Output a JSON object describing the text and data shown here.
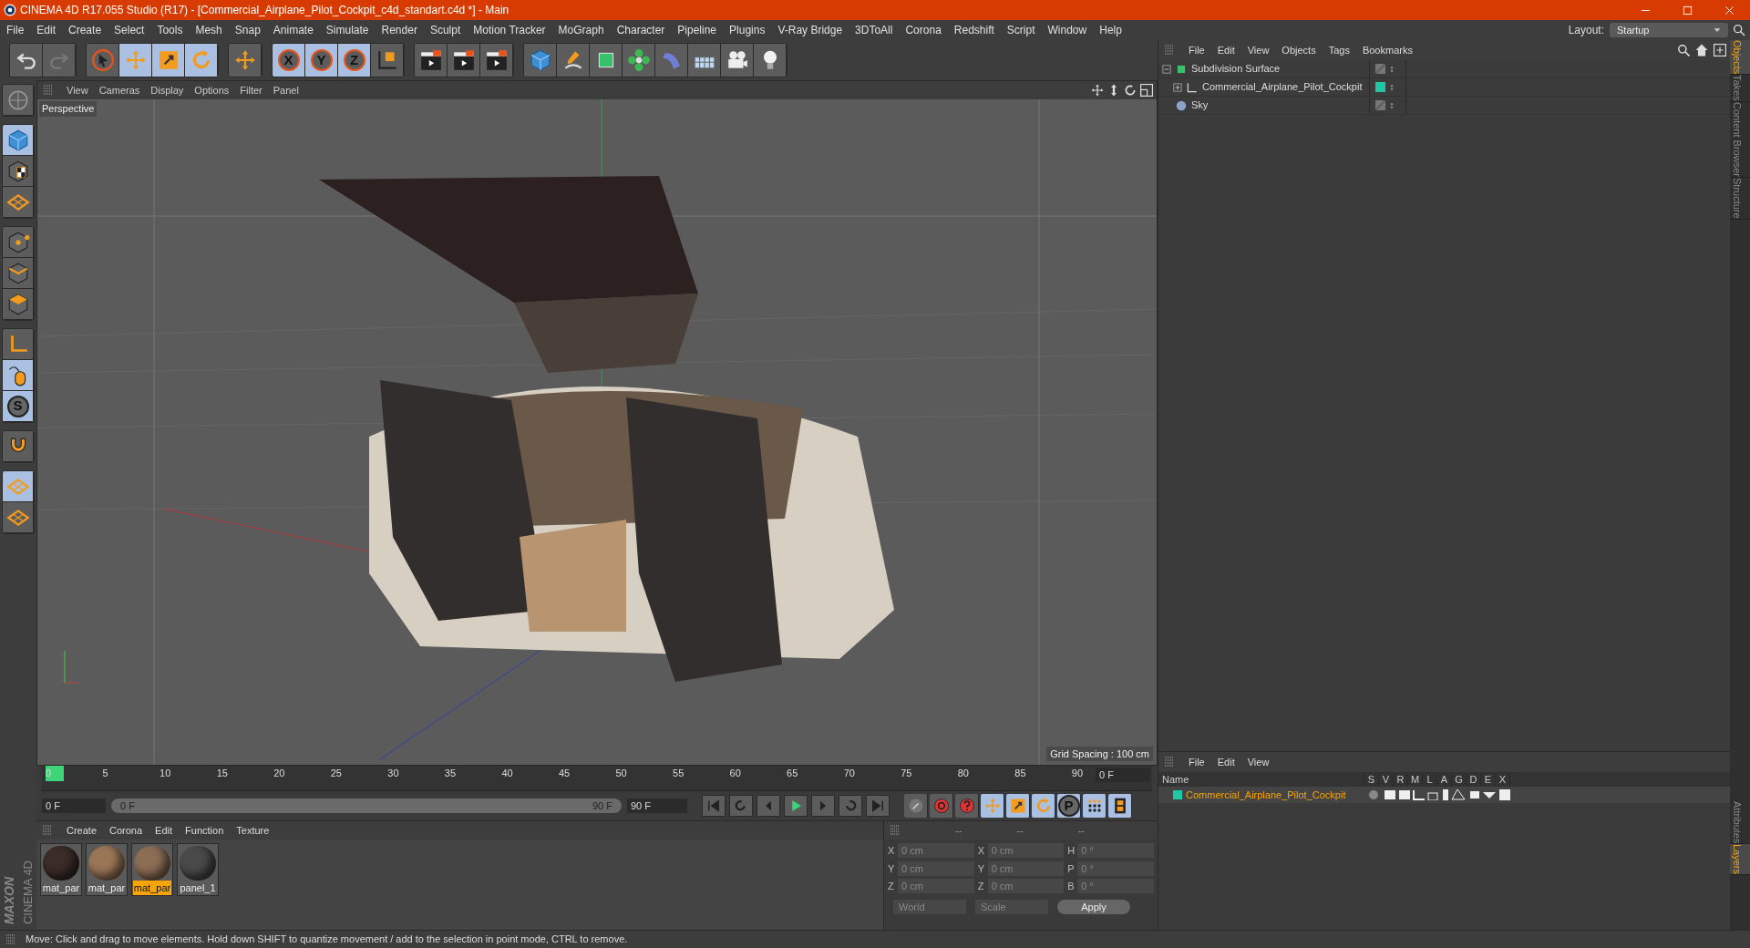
{
  "window": {
    "title": "CINEMA 4D R17.055 Studio (R17) - [Commercial_Airplane_Pilot_Cockpit_c4d_standart.c4d *] - Main"
  },
  "menu": [
    "File",
    "Edit",
    "Create",
    "Select",
    "Tools",
    "Mesh",
    "Snap",
    "Animate",
    "Simulate",
    "Render",
    "Sculpt",
    "Motion Tracker",
    "MoGraph",
    "Character",
    "Pipeline",
    "Plugins",
    "V-Ray Bridge",
    "3DToAll",
    "Corona",
    "Redshift",
    "Script",
    "Window",
    "Help"
  ],
  "layout": {
    "label": "Layout:",
    "value": "Startup"
  },
  "toolbar": [
    [
      {
        "kind": "undo",
        "active": false
      },
      {
        "kind": "redo",
        "active": false
      }
    ],
    [
      {
        "kind": "select",
        "active": false
      },
      {
        "kind": "move",
        "active": true
      },
      {
        "kind": "scale",
        "active": true
      },
      {
        "kind": "rotate",
        "active": true
      }
    ],
    [
      {
        "kind": "move",
        "active": false
      }
    ],
    [
      {
        "kind": "axis",
        "label": "X",
        "active": true
      },
      {
        "kind": "axis",
        "label": "Y",
        "active": true
      },
      {
        "kind": "axis",
        "label": "Z",
        "active": true
      },
      {
        "kind": "coords",
        "active": false
      }
    ],
    [
      {
        "kind": "render",
        "active": false
      },
      {
        "kind": "render",
        "active": false
      },
      {
        "kind": "render",
        "active": false
      }
    ],
    [
      {
        "kind": "cube",
        "active": false
      },
      {
        "kind": "pen",
        "active": false
      },
      {
        "kind": "subdiv",
        "active": false
      },
      {
        "kind": "cloner",
        "active": false
      },
      {
        "kind": "deformer",
        "active": false
      },
      {
        "kind": "floor",
        "active": false
      },
      {
        "kind": "camera",
        "active": false
      },
      {
        "kind": "light",
        "active": false
      }
    ]
  ],
  "left_tools": [
    [
      {
        "kind": "model",
        "active": false
      }
    ],
    [
      {
        "kind": "cube",
        "active": true
      },
      {
        "kind": "texture",
        "active": false
      },
      {
        "kind": "grid",
        "active": false
      }
    ],
    [
      {
        "kind": "points",
        "active": false
      },
      {
        "kind": "edges",
        "active": false
      },
      {
        "kind": "polygons",
        "active": false
      }
    ],
    [
      {
        "kind": "axis",
        "active": false
      },
      {
        "kind": "mouse",
        "active": true
      },
      {
        "kind": "snap",
        "label": "S",
        "active": true
      }
    ],
    [
      {
        "kind": "magnet",
        "active": false
      }
    ],
    [
      {
        "kind": "grid",
        "active": true
      },
      {
        "kind": "grid",
        "active": false
      }
    ]
  ],
  "viewport": {
    "menu": [
      "View",
      "Cameras",
      "Display",
      "Options",
      "Filter",
      "Panel"
    ],
    "camera": "Perspective",
    "grid_spacing": "Grid Spacing : 100 cm"
  },
  "objects_panel": {
    "menu": [
      "File",
      "Edit",
      "View",
      "Objects",
      "Tags",
      "Bookmarks"
    ],
    "items": [
      {
        "name": "Subdivision Surface",
        "kind": "subdiv",
        "expanded": true,
        "children": [
          {
            "name": "Commercial_Airplane_Pilot_Cockpit",
            "kind": "null",
            "expanded": false,
            "color": "#1fc7a6"
          }
        ]
      },
      {
        "name": "Sky",
        "kind": "sky"
      }
    ]
  },
  "side_tabs": [
    {
      "label": "Objects",
      "selected": true
    },
    {
      "label": "Takes",
      "selected": false
    },
    {
      "label": "Content Browser",
      "selected": false
    },
    {
      "label": "Structure",
      "selected": false
    }
  ],
  "timeline": {
    "ticks": [
      "0",
      "5",
      "10",
      "15",
      "20",
      "25",
      "30",
      "35",
      "40",
      "45",
      "50",
      "55",
      "60",
      "65",
      "70",
      "75",
      "80",
      "85",
      "90"
    ],
    "current": "0 F",
    "start": "0 F",
    "level": 1,
    "range_start": "0 F",
    "range_end": "90 F",
    "end": "90 F"
  },
  "transport": [
    {
      "kind": "first"
    },
    {
      "kind": "prevkey"
    },
    {
      "kind": "prev"
    },
    {
      "kind": "play"
    },
    {
      "kind": "next"
    },
    {
      "kind": "nextkey"
    },
    {
      "kind": "last"
    }
  ],
  "key_tools": [
    {
      "kind": "keys",
      "active": false
    },
    {
      "kind": "record",
      "active": false
    },
    {
      "kind": "help",
      "active": false
    },
    {
      "kind": "move",
      "active": true
    },
    {
      "kind": "scale",
      "active": true
    },
    {
      "kind": "rotate",
      "active": true
    },
    {
      "kind": "param",
      "label": "P",
      "active": true
    },
    {
      "kind": "dots",
      "active": true
    },
    {
      "kind": "film",
      "active": true
    }
  ],
  "materials": {
    "menu": [
      "Create",
      "Corona",
      "Edit",
      "Function",
      "Texture"
    ],
    "items": [
      {
        "name": "mat_par",
        "selected": false,
        "color": "#3a2c28"
      },
      {
        "name": "mat_par",
        "selected": false,
        "color": "#9a7656"
      },
      {
        "name": "mat_par",
        "selected": true,
        "color": "#8c6e55"
      },
      {
        "name": "panel_1",
        "selected": false,
        "color": "#4a4a4a"
      }
    ]
  },
  "logo": {
    "brand": "MAXON",
    "product": "CINEMA 4D"
  },
  "coordinates": {
    "disabled": true,
    "headers": [
      "--",
      "--",
      "--"
    ],
    "columns": [
      [
        {
          "label": "X",
          "value": "0 cm"
        },
        {
          "label": "Y",
          "value": "0 cm"
        },
        {
          "label": "Z",
          "value": "0 cm"
        }
      ],
      [
        {
          "label": "X",
          "value": "0 cm"
        },
        {
          "label": "Y",
          "value": "0 cm"
        },
        {
          "label": "Z",
          "value": "0 cm"
        }
      ],
      [
        {
          "label": "H",
          "value": "0 °"
        },
        {
          "label": "P",
          "value": "0 °"
        },
        {
          "label": "B",
          "value": "0 °"
        }
      ]
    ],
    "dropdowns": [
      "World",
      "Scale"
    ],
    "apply": "Apply"
  },
  "layers_panel": {
    "menu": [
      "File",
      "Edit",
      "View"
    ],
    "columns": [
      "Name",
      "S",
      "V",
      "R",
      "M",
      "L",
      "A",
      "G",
      "D",
      "E",
      "X"
    ],
    "rows": [
      {
        "name": "Commercial_Airplane_Pilot_Cockpit",
        "color": "#1fc7a6"
      }
    ]
  },
  "bottom_side_tabs": [
    {
      "label": "Attributes",
      "selected": false
    },
    {
      "label": "Layers",
      "selected": true
    }
  ],
  "status_bar": "Move: Click and drag to move elements. Hold down SHIFT to quantize movement / add to the selection in point mode, CTRL to remove."
}
